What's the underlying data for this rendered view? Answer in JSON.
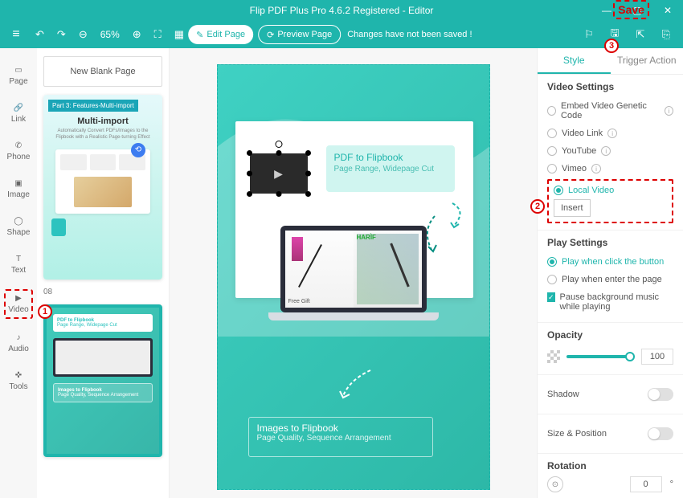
{
  "titlebar": {
    "title": "Flip PDF Plus Pro 4.6.2 Registered - Editor"
  },
  "toolbar": {
    "zoom": "65%",
    "edit_label": "Edit Page",
    "preview_label": "Preview Page",
    "status": "Changes have not been saved !"
  },
  "sidebar": {
    "items": [
      {
        "label": "Page"
      },
      {
        "label": "Link"
      },
      {
        "label": "Phone"
      },
      {
        "label": "Image"
      },
      {
        "label": "Shape"
      },
      {
        "label": "Text"
      },
      {
        "label": "Video"
      },
      {
        "label": "Audio"
      },
      {
        "label": "Tools"
      }
    ]
  },
  "thumbs": {
    "new_page": "New Blank Page",
    "a": {
      "tag": "Part 3: Features-Multi-import",
      "title": "Multi-import",
      "sub": "Automatically Convert PDFs/Images to the Flipbook with a Realistic Page-turning Effect"
    },
    "page_num": "08",
    "b": {
      "c1_title": "PDF to Flipbook",
      "c1_sub": "Page Range, Widepage Cut",
      "c2_title": "Images to Flipbook",
      "c2_sub": "Page Quality, Sequence Arrangement"
    }
  },
  "canvas": {
    "callout_top": {
      "title": "PDF to Flipbook",
      "sub": "Page Range, Widepage Cut"
    },
    "callout_bottom": {
      "title": "Images to Flipbook",
      "sub": "Page Quality, Sequence Arrangement"
    },
    "laptop": {
      "gift": "Free Gift"
    }
  },
  "props": {
    "tabs": {
      "style": "Style",
      "trigger": "Trigger Action"
    },
    "video_settings": {
      "title": "Video Settings",
      "opt_embed": "Embed Video Genetic Code",
      "opt_link": "Video Link",
      "opt_yt": "YouTube",
      "opt_vimeo": "Vimeo",
      "opt_local": "Local Video",
      "insert": "Insert"
    },
    "play": {
      "title": "Play Settings",
      "opt_click": "Play when click the button",
      "opt_enter": "Play when enter the page",
      "chk_pause": "Pause background music while playing"
    },
    "opacity": {
      "title": "Opacity",
      "value": "100"
    },
    "shadow": "Shadow",
    "sizepos": "Size & Position",
    "rotation": {
      "title": "Rotation",
      "value": "0",
      "unit": "°"
    }
  },
  "annotations": {
    "save": "Save",
    "step1": "1",
    "step2": "2",
    "step3": "3"
  }
}
